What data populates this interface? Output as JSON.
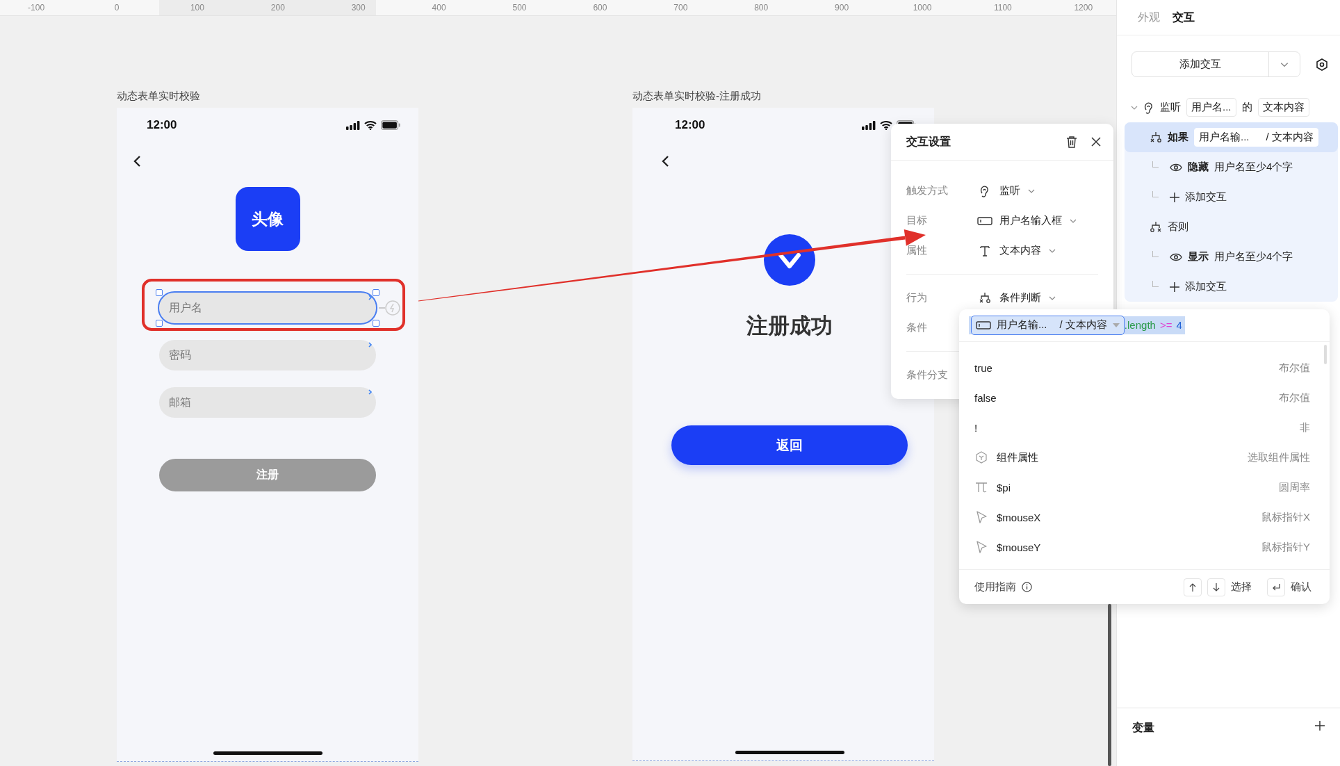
{
  "ruler": {
    "ticks": [
      "-100",
      "0",
      "100",
      "200",
      "300",
      "400",
      "500",
      "600",
      "700",
      "800",
      "900",
      "1000",
      "1100",
      "1200"
    ]
  },
  "left_frame": {
    "title": "动态表单实时校验",
    "time": "12:00",
    "avatar": "头像",
    "fields": [
      {
        "placeholder": "用户名",
        "selected": true
      },
      {
        "placeholder": "密码",
        "selected": false
      },
      {
        "placeholder": "邮箱",
        "selected": false
      }
    ],
    "submit_button": {
      "label": "注册",
      "disabled": true
    }
  },
  "right_frame": {
    "title": "动态表单实时校验-注册成功",
    "time": "12:00",
    "heading": "注册成功",
    "button": "返回"
  },
  "interaction_dialog": {
    "title": "交互设置",
    "sections": [
      [
        {
          "label": "触发方式",
          "value": "监听",
          "kind": "listen"
        },
        {
          "label": "目标",
          "value": "用户名输入框",
          "kind": "target"
        },
        {
          "label": "属性",
          "value": "文本内容",
          "kind": "property"
        }
      ],
      [
        {
          "label": "行为",
          "value": "条件判断",
          "kind": "branch"
        },
        {
          "label": "条件",
          "kind": "plain"
        }
      ],
      [
        {
          "label": "条件分支",
          "kind": "plain"
        }
      ]
    ]
  },
  "condition_editor": {
    "target": "用户名输...",
    "property": "/ 文本内容",
    "member": ".length",
    "operator": ">=",
    "operand": "4",
    "options": [
      {
        "label": "true",
        "description": "布尔值",
        "kind": "plain"
      },
      {
        "label": "false",
        "description": "布尔值",
        "kind": "plain"
      },
      {
        "label": "!",
        "description": "非",
        "kind": "plain"
      },
      {
        "label": "组件属性",
        "description": "选取组件属性",
        "kind": "component"
      },
      {
        "label": "$pi",
        "description": "圆周率",
        "kind": "pi"
      },
      {
        "label": "$mouseX",
        "description": "鼠标指针X",
        "kind": "pointer"
      },
      {
        "label": "$mouseY",
        "description": "鼠标指针Y",
        "kind": "pointer"
      }
    ],
    "footer": {
      "guide": "使用指南",
      "select": "选择",
      "confirm": "确认"
    }
  },
  "inspector": {
    "tabs": [
      {
        "label": "外观",
        "selected": false
      },
      {
        "label": "交互",
        "selected": true
      }
    ],
    "add_button": "添加交互",
    "tree": {
      "expanded": true,
      "event": "监听",
      "target": "用户名...",
      "connector": "的",
      "property": "文本内容",
      "children": [
        {
          "kind": "if",
          "label": "如果",
          "selected": true,
          "target": "用户名输...",
          "property": "/ 文本内容",
          "children": [
            {
              "kind": "action",
              "verb": "隐藏",
              "object": "用户名至少4个字"
            },
            {
              "kind": "add",
              "label": "添加交互"
            }
          ]
        },
        {
          "kind": "else",
          "label": "否则",
          "selected": false,
          "children": [
            {
              "kind": "action",
              "verb": "显示",
              "object": "用户名至少4个字"
            },
            {
              "kind": "add",
              "label": "添加交互"
            }
          ]
        }
      ]
    },
    "variables": {
      "title": "变量"
    }
  }
}
